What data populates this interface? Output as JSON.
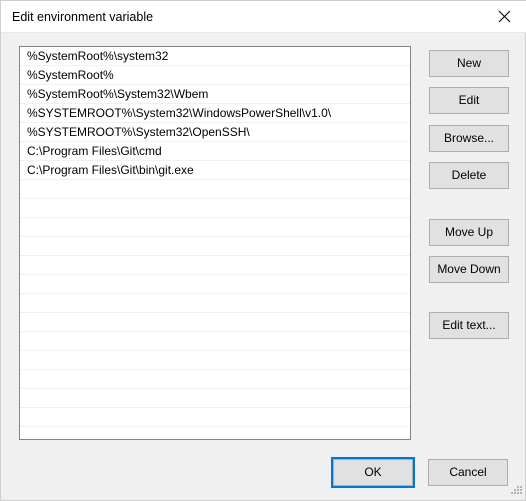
{
  "window": {
    "title": "Edit environment variable",
    "close_icon": "close-icon",
    "resize_grip_icon": "resize-grip-icon"
  },
  "colors": {
    "titlebar_bg": "#ffffff",
    "dialog_bg": "#f0f0f0",
    "button_face": "#e1e1e1",
    "button_border": "#adadad",
    "listbox_bg": "#ffffff",
    "listbox_border": "#848484",
    "row_separator": "#f0f0f0",
    "focus_accent": "#0078d7",
    "text": "#000000"
  },
  "listbox": {
    "entries": [
      "%SystemRoot%\\system32",
      "%SystemRoot%",
      "%SystemRoot%\\System32\\Wbem",
      "%SYSTEMROOT%\\System32\\WindowsPowerShell\\v1.0\\",
      "%SYSTEMROOT%\\System32\\OpenSSH\\",
      "C:\\Program Files\\Git\\cmd",
      "C:\\Program Files\\Git\\bin\\git.exe"
    ],
    "empty_row_count": 13,
    "selected_index": null
  },
  "side_buttons": {
    "new": "New",
    "edit": "Edit",
    "browse": "Browse...",
    "delete": "Delete",
    "move_up": "Move Up",
    "move_down": "Move Down",
    "edit_text": "Edit text..."
  },
  "footer": {
    "ok": "OK",
    "cancel": "Cancel",
    "default_button": "OK"
  }
}
